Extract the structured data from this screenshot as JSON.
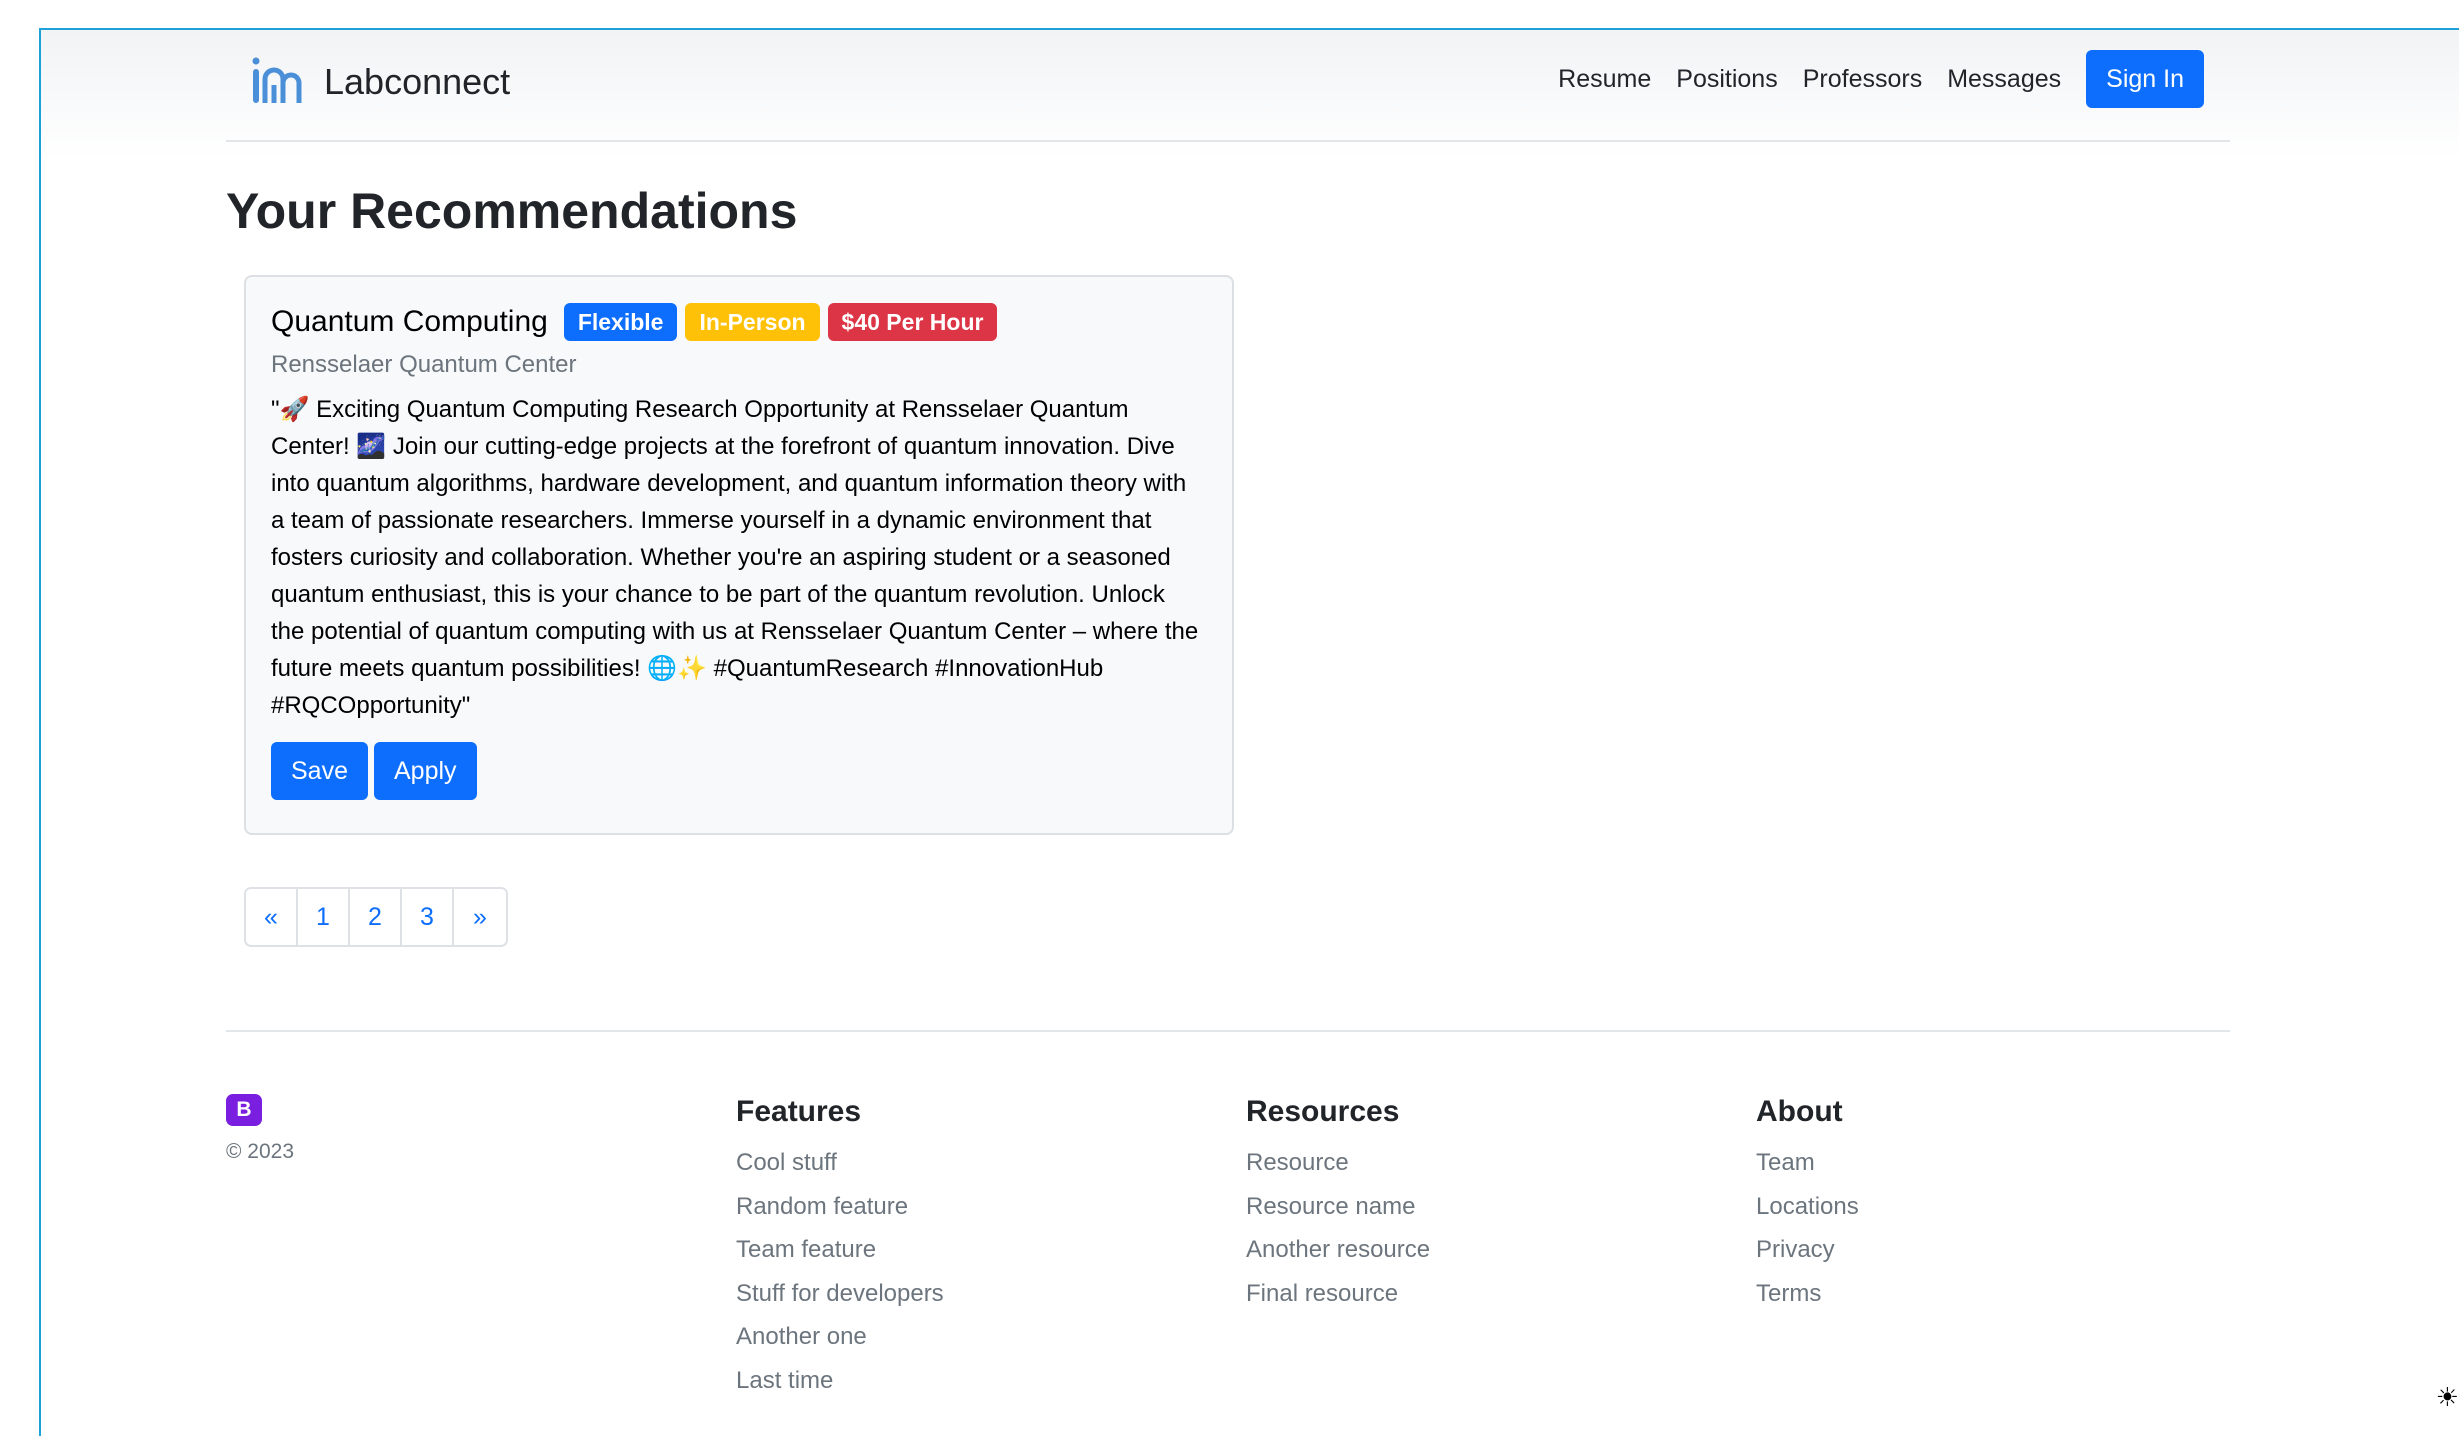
{
  "navbar": {
    "brand": "Labconnect",
    "links": [
      "Resume",
      "Positions",
      "Professors",
      "Messages"
    ],
    "signin_label": "Sign In"
  },
  "page_title": "Your Recommendations",
  "card": {
    "title": "Quantum Computing",
    "badges": [
      "Flexible",
      "In-Person",
      "$40 Per Hour"
    ],
    "subtitle": "Rensselaer Quantum Center",
    "text": "\"🚀 Exciting Quantum Computing Research Opportunity at Rensselaer Quantum Center! 🌌 Join our cutting-edge projects at the forefront of quantum innovation. Dive into quantum algorithms, hardware development, and quantum information theory with a team of passionate researchers. Immerse yourself in a dynamic environment that fosters curiosity and collaboration. Whether you're an aspiring student or a seasoned quantum enthusiast, this is your chance to be part of the quantum revolution. Unlock the potential of quantum computing with us at Rensselaer Quantum Center – where the future meets quantum possibilities! 🌐✨ #QuantumResearch #InnovationHub #RQCOpportunity\"",
    "save_label": "Save",
    "apply_label": "Apply"
  },
  "pagination": [
    "«",
    "1",
    "2",
    "3",
    "»"
  ],
  "footer": {
    "logo_letter": "B",
    "copyright": "© 2023",
    "columns": [
      {
        "title": "Features",
        "items": [
          "Cool stuff",
          "Random feature",
          "Team feature",
          "Stuff for developers",
          "Another one",
          "Last time"
        ]
      },
      {
        "title": "Resources",
        "items": [
          "Resource",
          "Resource name",
          "Another resource",
          "Final resource"
        ]
      },
      {
        "title": "About",
        "items": [
          "Team",
          "Locations",
          "Privacy",
          "Terms"
        ]
      }
    ]
  },
  "theme_toggle_icon": "sun-icon",
  "colors": {
    "primary": "#0d6efd",
    "warning": "#ffc107",
    "danger": "#dc3545",
    "muted": "#6c757d",
    "bootstrap_purple": "#7a1ee0"
  }
}
